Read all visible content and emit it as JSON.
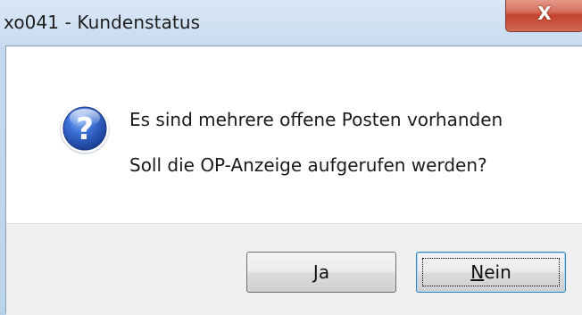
{
  "window": {
    "title": "xo041 - Kundenstatus",
    "close_glyph": "X"
  },
  "dialog": {
    "icon": "question-icon",
    "message_line1": "Es sind mehrere offene Posten vorhanden",
    "message_line2": "Soll die OP-Anzeige aufgerufen werden?"
  },
  "buttons": {
    "yes": {
      "accel": "J",
      "rest": "a"
    },
    "no": {
      "accel": "N",
      "rest": "ein"
    }
  },
  "colors": {
    "icon_blue": "#2f63c9",
    "close_red": "#c4432c",
    "default_button_border": "#3c7fb1"
  }
}
